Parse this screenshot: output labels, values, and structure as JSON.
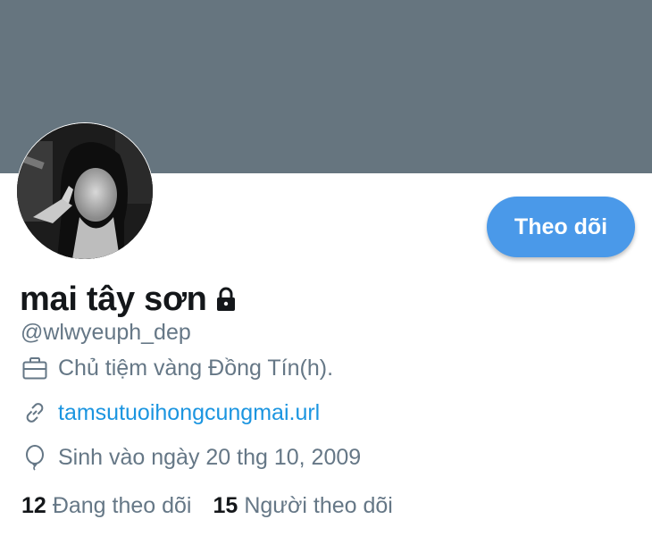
{
  "profile": {
    "display_name": "mai tây sơn",
    "handle": "@wlwyeuph_dep",
    "follow_label": "Theo dõi",
    "bio_job": "Chủ tiệm vàng Đồng Tín(h).",
    "website": "tamsutuoihongcungmai.url",
    "birthday": "Sinh vào ngày 20 thg 10, 2009",
    "protected": true
  },
  "stats": {
    "following_count": "12",
    "following_label": "Đang theo dõi",
    "followers_count": "15",
    "followers_label": "Người theo dõi"
  },
  "icons": {
    "lock": "lock-icon",
    "job": "briefcase-icon",
    "link": "link-icon",
    "birthday": "balloon-icon"
  },
  "colors": {
    "banner": "#66757f",
    "accent": "#4a99e9",
    "link": "#1b95e0",
    "secondary_text": "#657786"
  }
}
